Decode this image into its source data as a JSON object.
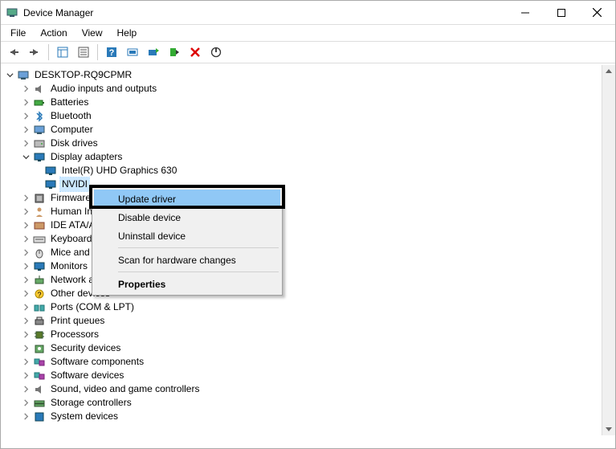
{
  "window": {
    "title": "Device Manager"
  },
  "menu": {
    "file": "File",
    "action": "Action",
    "view": "View",
    "help": "Help"
  },
  "tree": {
    "root": "DESKTOP-RQ9CPMR",
    "categories": [
      {
        "label": "Audio inputs and outputs"
      },
      {
        "label": "Batteries"
      },
      {
        "label": "Bluetooth"
      },
      {
        "label": "Computer"
      },
      {
        "label": "Disk drives"
      },
      {
        "label": "Display adapters",
        "expanded": true,
        "children": [
          {
            "label": "Intel(R) UHD Graphics 630"
          },
          {
            "label": "NVIDI",
            "selected": true
          }
        ]
      },
      {
        "label": "Firmware"
      },
      {
        "label": "Human In"
      },
      {
        "label": "IDE ATA/A"
      },
      {
        "label": "Keyboards"
      },
      {
        "label": "Mice and"
      },
      {
        "label": "Monitors"
      },
      {
        "label": "Network adapters"
      },
      {
        "label": "Other devices"
      },
      {
        "label": "Ports (COM & LPT)"
      },
      {
        "label": "Print queues"
      },
      {
        "label": "Processors"
      },
      {
        "label": "Security devices"
      },
      {
        "label": "Software components"
      },
      {
        "label": "Software devices"
      },
      {
        "label": "Sound, video and game controllers"
      },
      {
        "label": "Storage controllers"
      },
      {
        "label": "System devices"
      }
    ]
  },
  "context_menu": {
    "update_driver": "Update driver",
    "disable_device": "Disable device",
    "uninstall_device": "Uninstall device",
    "scan_hardware": "Scan for hardware changes",
    "properties": "Properties"
  }
}
